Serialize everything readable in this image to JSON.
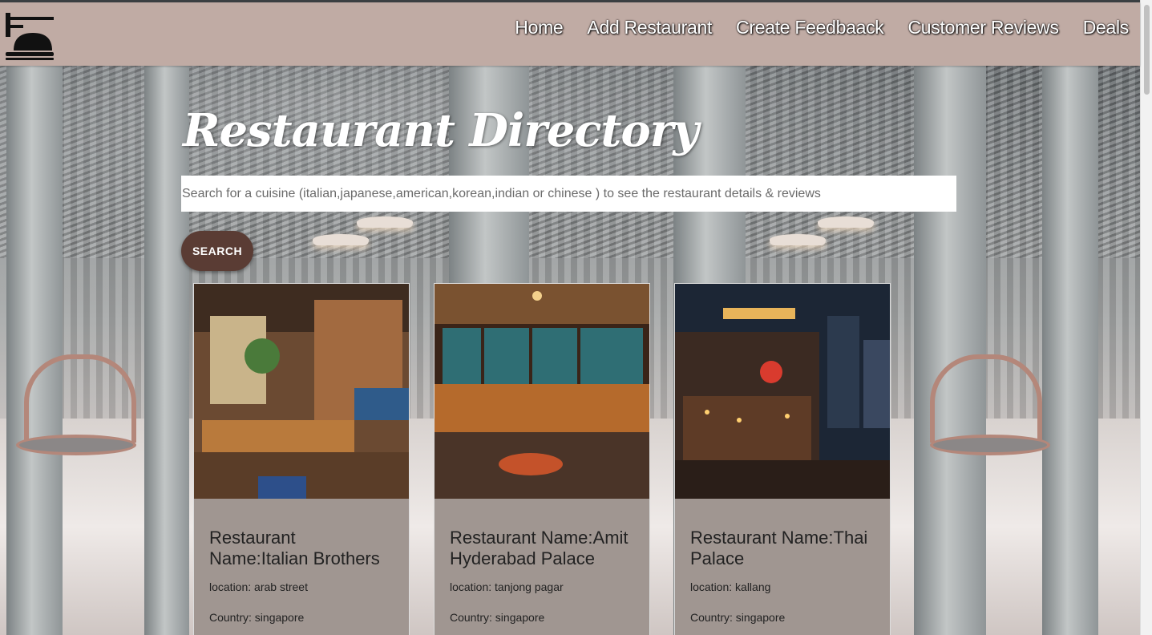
{
  "nav": {
    "logo_icon": "restaurant-cloche-icon",
    "links": [
      {
        "label": "Home"
      },
      {
        "label": "Add Restaurant"
      },
      {
        "label": "Create Feedbaack"
      },
      {
        "label": "Customer Reviews"
      },
      {
        "label": "Deals"
      }
    ]
  },
  "hero": {
    "title": "Restaurant Directory",
    "search_placeholder": "Search for a cuisine (italian,japanese,american,korean,indian or chinese ) to see the restaurant details & reviews",
    "search_button": "SEARCH"
  },
  "cards": [
    {
      "name": "Restaurant Name:Italian Brothers",
      "location": "location: arab street",
      "country": "Country: singapore",
      "image_icon": "restaurant-interior-photo"
    },
    {
      "name": "Restaurant Name:Amit Hyderabad Palace",
      "location": "location: tanjong pagar",
      "country": "Country: singapore",
      "image_icon": "restaurant-dining-photo"
    },
    {
      "name": "Restaurant Name:Thai Palace",
      "location": "location: kallang",
      "country": "Country: singapore",
      "image_icon": "street-restaurant-night-photo"
    }
  ],
  "colors": {
    "navbar": "#c0aba4",
    "search_button": "#5a3c34",
    "card_body": "#a09691"
  }
}
